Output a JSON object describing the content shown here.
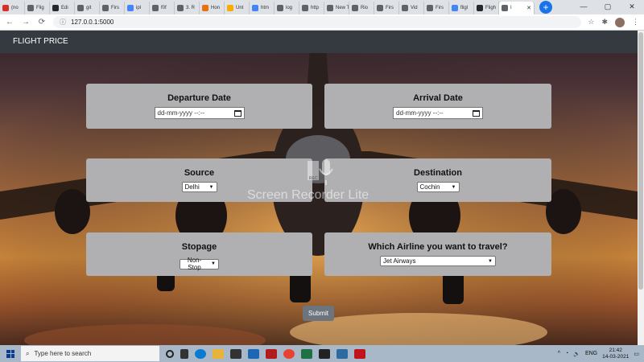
{
  "browser": {
    "tabs": [
      {
        "label": "(no",
        "color": "#d93025"
      },
      {
        "label": "Flig",
        "color": "#5f6368"
      },
      {
        "label": "Edi",
        "color": "#24292e"
      },
      {
        "label": "git",
        "color": "#5f6368"
      },
      {
        "label": "Firs",
        "color": "#5f6368"
      },
      {
        "label": "ipl",
        "color": "#4285f4"
      },
      {
        "label": "f0f",
        "color": "#5f6368"
      },
      {
        "label": "3. R",
        "color": "#5f6368"
      },
      {
        "label": "Hon",
        "color": "#e8710a"
      },
      {
        "label": "Unt",
        "color": "#f9ab00"
      },
      {
        "label": "htm",
        "color": "#4285f4"
      },
      {
        "label": "log",
        "color": "#5f6368"
      },
      {
        "label": "http",
        "color": "#5f6368"
      },
      {
        "label": "New Tab",
        "color": "#5f6368"
      },
      {
        "label": "Rio",
        "color": "#5f6368"
      },
      {
        "label": "Firs",
        "color": "#5f6368"
      },
      {
        "label": "Vid",
        "color": "#5f6368"
      },
      {
        "label": "Firs",
        "color": "#5f6368"
      },
      {
        "label": "fligl",
        "color": "#4285f4"
      },
      {
        "label": "Fligh",
        "color": "#24292e"
      },
      {
        "label": "I",
        "color": "#5f6368"
      }
    ],
    "url": "127.0.0.1:5000",
    "window_controls": {
      "minimize": "—",
      "maximize": "▢",
      "close": "✕"
    }
  },
  "navbar": {
    "brand": "FLIGHT PRICE"
  },
  "form": {
    "departure": {
      "label": "Departure Date",
      "placeholder": "dd-mm-yyyy --:--"
    },
    "arrival": {
      "label": "Arrival Date",
      "placeholder": "dd-mm-yyyy --:--"
    },
    "source": {
      "label": "Source",
      "value": "Delhi"
    },
    "destination": {
      "label": "Destination",
      "value": "Cochin"
    },
    "stopage": {
      "label": "Stopage",
      "value": "Non-Stop"
    },
    "airline": {
      "label": "Which Airline you want to travel?",
      "value": "Jet Airways"
    },
    "submit": "Submit"
  },
  "watermark": {
    "text": "Screen Recorder Lite",
    "badge": "REC"
  },
  "taskbar": {
    "search_placeholder": "Type here to search",
    "language": "ENG",
    "time": "21:42",
    "date": "14-03-2021"
  },
  "colors": {
    "navbar": "#343a40",
    "card": "#b0b0b2",
    "submit": "#6c757d",
    "taskbar": "#a8b8c8"
  }
}
